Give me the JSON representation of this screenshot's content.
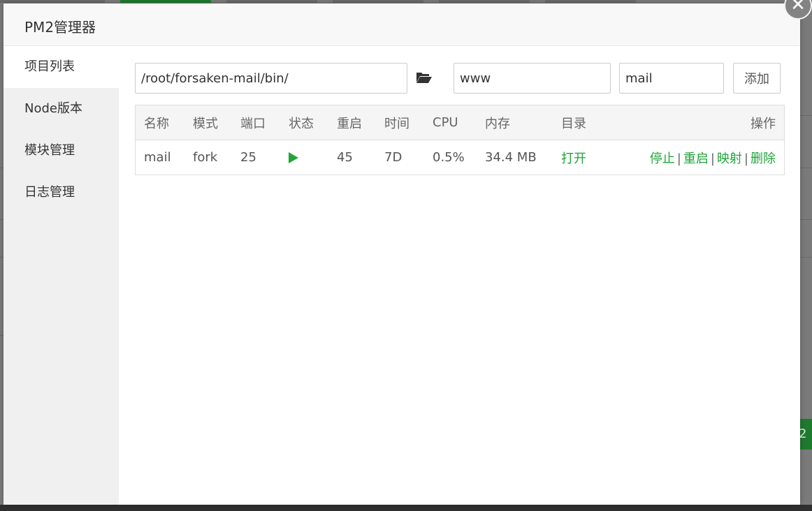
{
  "modal": {
    "title": "PM2管理器",
    "close_label": "✕"
  },
  "sidebar": {
    "items": [
      {
        "label": "项目列表",
        "active": true
      },
      {
        "label": "Node版本"
      },
      {
        "label": "模块管理"
      },
      {
        "label": "日志管理"
      }
    ]
  },
  "form": {
    "path_value": "/root/forsaken-mail/bin/",
    "user_value": "www",
    "name_value": "mail",
    "add_label": "添加"
  },
  "table": {
    "headers": {
      "name": "名称",
      "mode": "模式",
      "port": "端口",
      "status": "状态",
      "restart": "重启",
      "time": "时间",
      "cpu": "CPU",
      "memory": "内存",
      "dir": "目录",
      "ops": "操作"
    },
    "rows": [
      {
        "name": "mail",
        "mode": "fork",
        "port": "25",
        "status": "running",
        "restart": "45",
        "time": "7D",
        "cpu": "0.5%",
        "memory": "34.4 MB",
        "dir": "打开",
        "ops": {
          "stop": "停止",
          "restart": "重启",
          "map": "映射",
          "delete": "删除",
          "sep": "|"
        }
      }
    ]
  },
  "background": {
    "button_text": "2"
  },
  "colors": {
    "accent": "#20a53a",
    "bg_green": "#1e7a2e"
  }
}
